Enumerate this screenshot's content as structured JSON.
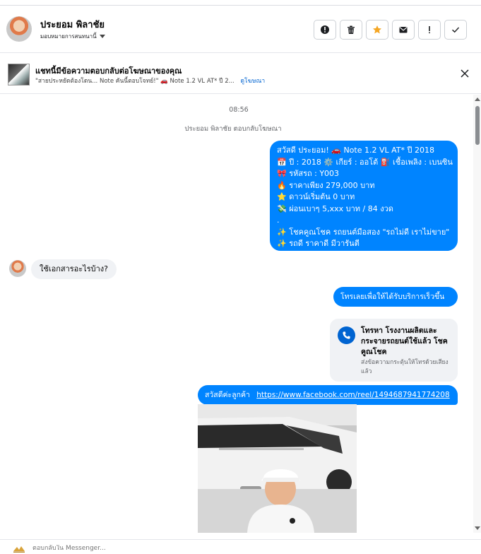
{
  "header": {
    "name": "ประยอม พิลาชัย",
    "assign_label": "มอบหมายการสนทนานี้"
  },
  "ad": {
    "title": "แชทนี้มีข้อความตอบกลับต่อโฆษณาของคุณ",
    "snippet": "\"สายประหยัดต้องโดน... Note คันนี้ตอบโจทย์!\" 🚗 Note 1.2 VL AT* ปี 2...",
    "link_label": "ดูโฆษณา"
  },
  "chat": {
    "timestamp": "08:56",
    "reply_note": "ประยอม พิลาชัย ตอบกลับโฆษณา",
    "ad_message_lines": [
      "สวัสดี ประยอม! 🚗 Note 1.2 VL AT* ปี 2018",
      "📅 ปี : 2018 ⚙️ เกียร์ : ออโต้ ⛽ เชื้อเพลิง : เบนซิน",
      "🎀 รหัสรถ : Y003",
      "🔥 ราคาเพียง 279,000 บาท",
      "⭐ ดาวน์เริ่มต้น 0 บาท",
      "💸 ผ่อนเบาๆ 5,xxx บาท / 84 งวด",
      ".",
      "✨ โชคคูณโชค รถยนต์มือสอง \"รถไม่ดี เราไม่ขาย\"",
      "✨ รถดี ราคาดี มีวารันตี"
    ],
    "incoming_message": "ใช้เอกสารอะไรบ้าง?",
    "call_prompt": "โทรเลยเพื่อให้ได้รับบริการเร็วขึ้น",
    "call_card": {
      "title": "โทรหา โรงงานผลิตและกระจายรถยนต์ใช้แล้ว โชคคูณโชค",
      "subtitle": "ส่งข้อความกระตุ้นให้โทรด้วยเสียงแล้ว"
    },
    "greeting": "สวัสดีค่ะลูกค้า",
    "reel_url": "https://www.facebook.com/reel/1494687941774208"
  },
  "composer": {
    "placeholder": "ตอบกลับใน Messenger..."
  },
  "colors": {
    "outgoing_bubble": "#0084ff",
    "incoming_bubble": "#f0f2f5",
    "action_orange": "#f5a623",
    "link_blue": "#0064d1"
  }
}
